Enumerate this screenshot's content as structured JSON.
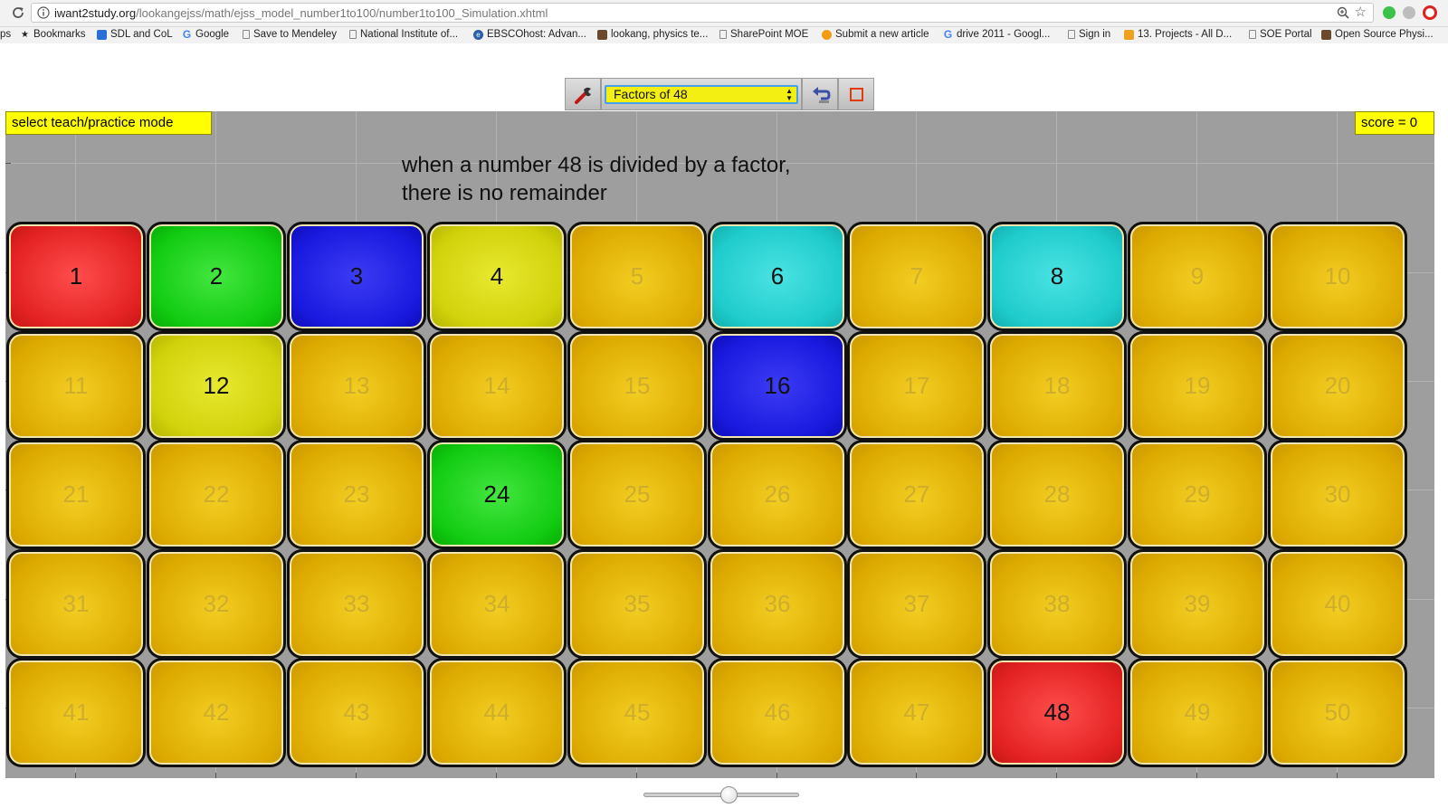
{
  "browser": {
    "url_host": "iwant2study.org",
    "url_path": "/lookangejss/math/ejss_model_number1to100/number1to100_Simulation.xhtml",
    "bookmarks": [
      {
        "label": "ps",
        "icon": "none"
      },
      {
        "label": "Bookmarks",
        "icon": "star-icon"
      },
      {
        "label": "SDL and CoL",
        "icon": "bookmark-blue-icon"
      },
      {
        "label": "Google",
        "icon": "google-icon"
      },
      {
        "label": "Save to Mendeley",
        "icon": "page-icon"
      },
      {
        "label": "National Institute of...",
        "icon": "page-icon"
      },
      {
        "label": "EBSCOhost: Advan...",
        "icon": "ebsco-icon"
      },
      {
        "label": "lookang, physics te...",
        "icon": "photo-icon"
      },
      {
        "label": "SharePoint MOE",
        "icon": "page-icon"
      },
      {
        "label": "Submit a new article",
        "icon": "orange-circle-icon"
      },
      {
        "label": "drive 2011 - Googl...",
        "icon": "google-icon"
      },
      {
        "label": "Sign in",
        "icon": "page-icon"
      },
      {
        "label": "13. Projects - All D...",
        "icon": "grid-icon"
      },
      {
        "label": "SOE Portal",
        "icon": "page-icon"
      },
      {
        "label": "Open Source Physi...",
        "icon": "photo-icon"
      }
    ]
  },
  "toolbar": {
    "selected_mode": "Factors of 48",
    "settings_icon": "wrench-icon",
    "undo_icon": "undo-icon",
    "stop_icon": "stop-square-icon"
  },
  "panel": {
    "mode_label": "select teach/practice mode",
    "score_label": "score = 0",
    "hint_line1": "when a number 48 is divided by a factor,",
    "hint_line2": "there is no remainder"
  },
  "colors": {
    "panel_bg": "#9e9e9e",
    "label_bg": "#ffff00",
    "tile_default": "#dcaa00",
    "select_bg": "#f4ef12"
  },
  "tiles": [
    {
      "n": "1",
      "c": "red"
    },
    {
      "n": "2",
      "c": "green"
    },
    {
      "n": "3",
      "c": "blue"
    },
    {
      "n": "4",
      "c": "yellow"
    },
    {
      "n": "5",
      "c": "gold"
    },
    {
      "n": "6",
      "c": "cyan"
    },
    {
      "n": "7",
      "c": "gold"
    },
    {
      "n": "8",
      "c": "cyan"
    },
    {
      "n": "9",
      "c": "gold"
    },
    {
      "n": "10",
      "c": "gold"
    },
    {
      "n": "11",
      "c": "gold"
    },
    {
      "n": "12",
      "c": "yellow"
    },
    {
      "n": "13",
      "c": "gold"
    },
    {
      "n": "14",
      "c": "gold"
    },
    {
      "n": "15",
      "c": "gold"
    },
    {
      "n": "16",
      "c": "blue"
    },
    {
      "n": "17",
      "c": "gold"
    },
    {
      "n": "18",
      "c": "gold"
    },
    {
      "n": "19",
      "c": "gold"
    },
    {
      "n": "20",
      "c": "gold"
    },
    {
      "n": "21",
      "c": "gold"
    },
    {
      "n": "22",
      "c": "gold"
    },
    {
      "n": "23",
      "c": "gold"
    },
    {
      "n": "24",
      "c": "green"
    },
    {
      "n": "25",
      "c": "gold"
    },
    {
      "n": "26",
      "c": "gold"
    },
    {
      "n": "27",
      "c": "gold"
    },
    {
      "n": "28",
      "c": "gold"
    },
    {
      "n": "29",
      "c": "gold"
    },
    {
      "n": "30",
      "c": "gold"
    },
    {
      "n": "31",
      "c": "gold"
    },
    {
      "n": "32",
      "c": "gold"
    },
    {
      "n": "33",
      "c": "gold"
    },
    {
      "n": "34",
      "c": "gold"
    },
    {
      "n": "35",
      "c": "gold"
    },
    {
      "n": "36",
      "c": "gold"
    },
    {
      "n": "37",
      "c": "gold"
    },
    {
      "n": "38",
      "c": "gold"
    },
    {
      "n": "39",
      "c": "gold"
    },
    {
      "n": "40",
      "c": "gold"
    },
    {
      "n": "41",
      "c": "gold"
    },
    {
      "n": "42",
      "c": "gold"
    },
    {
      "n": "43",
      "c": "gold"
    },
    {
      "n": "44",
      "c": "gold"
    },
    {
      "n": "45",
      "c": "gold"
    },
    {
      "n": "46",
      "c": "gold"
    },
    {
      "n": "47",
      "c": "gold"
    },
    {
      "n": "48",
      "c": "red"
    },
    {
      "n": "49",
      "c": "gold"
    },
    {
      "n": "50",
      "c": "gold"
    }
  ],
  "slider": {
    "value": 0.55
  }
}
